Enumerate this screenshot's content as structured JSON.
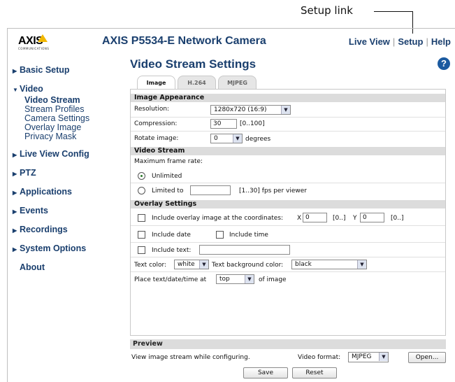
{
  "annotation": {
    "label": "Setup link"
  },
  "header": {
    "logo_text": "AXIS",
    "logo_subtext": "COMMUNICATIONS",
    "product_title": "AXIS P5534-E Network Camera",
    "links": {
      "live_view": "Live View",
      "setup": "Setup",
      "help": "Help",
      "separator": "|"
    }
  },
  "sidebar": {
    "items": [
      {
        "label": "Basic Setup"
      },
      {
        "label": "Video"
      },
      {
        "label": "Live View Config"
      },
      {
        "label": "PTZ"
      },
      {
        "label": "Applications"
      },
      {
        "label": "Events"
      },
      {
        "label": "Recordings"
      },
      {
        "label": "System Options"
      },
      {
        "label": "About"
      }
    ],
    "video_sub": [
      "Video Stream",
      "Stream Profiles",
      "Camera Settings",
      "Overlay Image",
      "Privacy Mask"
    ]
  },
  "main": {
    "title": "Video Stream Settings",
    "help_glyph": "?",
    "tabs": [
      {
        "label": "Image"
      },
      {
        "label": "H.264"
      },
      {
        "label": "MJPEG"
      }
    ]
  },
  "image_appearance": {
    "heading": "Image Appearance",
    "resolution_label": "Resolution:",
    "resolution_value": "1280x720 (16:9)",
    "compression_label": "Compression:",
    "compression_value": "30",
    "compression_range": "[0..100]",
    "rotate_label": "Rotate image:",
    "rotate_value": "0",
    "rotate_unit": "degrees"
  },
  "video_stream": {
    "heading": "Video Stream",
    "max_frame_rate_label": "Maximum frame rate:",
    "unlimited_label": "Unlimited",
    "limited_label": "Limited to",
    "limited_value": "",
    "limited_range": "[1..30] fps per viewer"
  },
  "overlay": {
    "heading": "Overlay Settings",
    "include_image_label": "Include overlay image at the coordinates:",
    "x_label": "X",
    "x_value": "0",
    "x_range": "[0..]",
    "y_label": "Y",
    "y_value": "0",
    "y_range": "[0..]",
    "include_date_label": "Include date",
    "include_time_label": "Include time",
    "include_text_label": "Include text:",
    "include_text_value": "",
    "text_color_label": "Text color:",
    "text_color_value": "white",
    "text_bg_label": "Text background color:",
    "text_bg_value": "black",
    "place_label": "Place text/date/time at",
    "place_value": "top",
    "place_suffix": "of image"
  },
  "preview": {
    "heading": "Preview",
    "description": "View image stream while configuring.",
    "format_label": "Video format:",
    "format_value": "MJPEG",
    "open_label": "Open..."
  },
  "actions": {
    "save_label": "Save",
    "reset_label": "Reset"
  },
  "colors": {
    "nav_blue": "#1a3f6e",
    "section_gray": "#dcdcdc",
    "logo_yellow": "#f2b800"
  },
  "icons": {
    "help": "help-icon",
    "nav_arrow": "arrow-right-icon",
    "nav_arrow_open": "arrow-down-icon"
  }
}
